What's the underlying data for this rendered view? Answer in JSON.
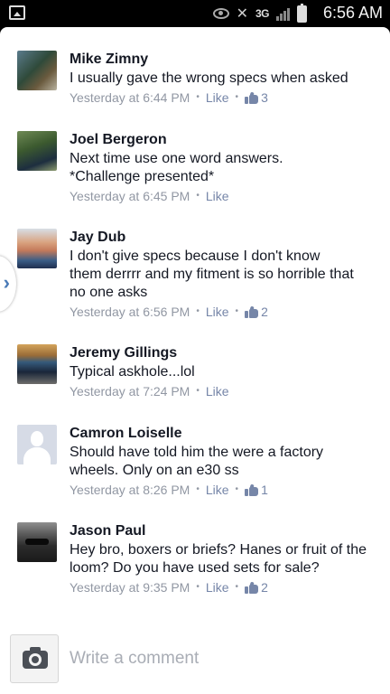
{
  "status_bar": {
    "network": "3G",
    "time": "6:56 AM"
  },
  "comments": [
    {
      "name": "Mike Zimny",
      "text": "I usually gave the wrong specs when asked",
      "time": "Yesterday at 6:44 PM",
      "like_label": "Like",
      "like_count": "3"
    },
    {
      "name": "Joel Bergeron",
      "text": "Next time use one word answers. *Challenge presented*",
      "time": "Yesterday at 6:45 PM",
      "like_label": "Like",
      "like_count": null
    },
    {
      "name": "Jay Dub",
      "text": "I don't give specs because I don't know them derrrr and my fitment is so horrible that no one asks",
      "time": "Yesterday at 6:56 PM",
      "like_label": "Like",
      "like_count": "2"
    },
    {
      "name": "Jeremy Gillings",
      "text": "Typical askhole...lol",
      "time": "Yesterday at 7:24 PM",
      "like_label": "Like",
      "like_count": null
    },
    {
      "name": "Camron Loiselle",
      "text": "Should have told him the were a factory wheels. Only on an e30 ss",
      "time": "Yesterday at 8:26 PM",
      "like_label": "Like",
      "like_count": "1"
    },
    {
      "name": "Jason Paul",
      "text": "Hey bro, boxers or briefs?  Hanes or fruit of the loom?  Do you have used sets for sale?",
      "time": "Yesterday at 9:35 PM",
      "like_label": "Like",
      "like_count": "2"
    }
  ],
  "side_tab": {
    "glyph": "›"
  },
  "composer": {
    "placeholder": "Write a comment",
    "camera_icon": "camera-icon"
  },
  "colors": {
    "name": "#141823",
    "meta": "#9197a3",
    "like": "#7686a8",
    "accent": "#4a7bb7"
  }
}
